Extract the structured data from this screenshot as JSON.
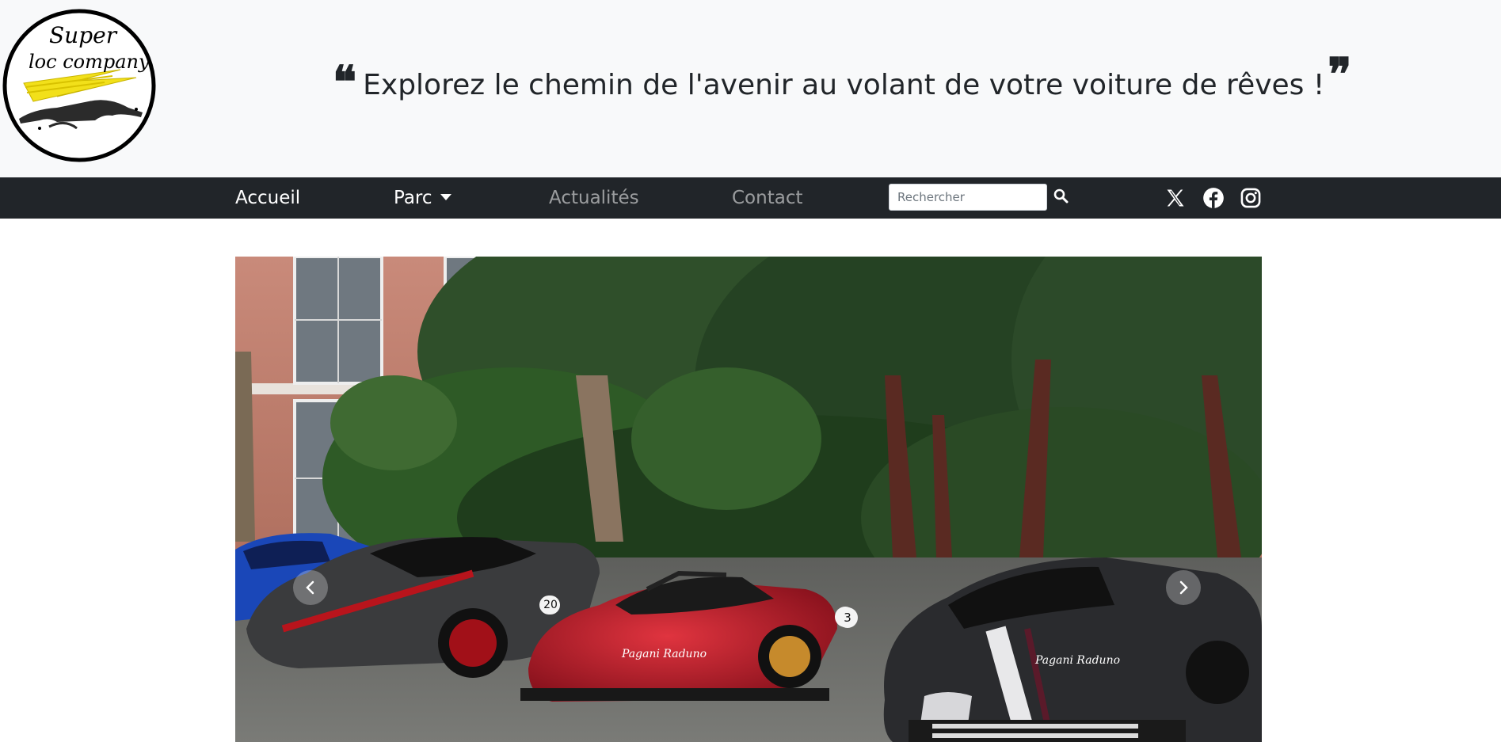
{
  "header": {
    "logo": {
      "line1": "Super",
      "line2": "loc company"
    },
    "tagline": "Explorez le chemin de l'avenir au volant de votre voiture de rêves !",
    "quote_open": "❝",
    "quote_close": "❞"
  },
  "nav": {
    "items": [
      {
        "label": "Accueil",
        "state": "active"
      },
      {
        "label": "Parc",
        "dropdown": true
      },
      {
        "label": "Actualités"
      },
      {
        "label": "Contact"
      }
    ],
    "search": {
      "placeholder": "Rechercher",
      "value": ""
    },
    "social": [
      "x-icon",
      "facebook-icon",
      "instagram-icon"
    ]
  },
  "carousel": {
    "image_description": "Three Pagani supercars parked in a row in front of a brick building and trees",
    "car_plates": [
      "20",
      "3"
    ],
    "car_branding": "Pagani Raduno",
    "controls": [
      "prev-arrow-icon",
      "next-arrow-icon"
    ]
  },
  "colors": {
    "header_bg": "#f8f9fa",
    "navbar_bg": "#212529",
    "text": "#212529"
  }
}
